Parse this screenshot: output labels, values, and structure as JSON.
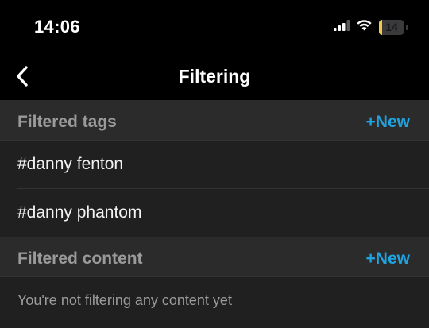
{
  "status_bar": {
    "time": "14:06",
    "battery_level": "14",
    "battery_fraction": 0.14,
    "icons": [
      "signal-bars-icon",
      "wifi-icon",
      "battery-icon"
    ],
    "battery_color": "#f4c84a"
  },
  "nav": {
    "back_icon": "chevron-left-icon",
    "title": "Filtering"
  },
  "sections": {
    "tags": {
      "title": "Filtered tags",
      "new_label": "+New",
      "items": [
        {
          "label": "#danny fenton"
        },
        {
          "label": "#danny phantom"
        }
      ]
    },
    "content": {
      "title": "Filtered content",
      "new_label": "+New",
      "empty_text": "You're not filtering any content yet"
    }
  },
  "colors": {
    "accent": "#1fa3e0",
    "background": "#202020",
    "header_background": "#2b2b2b",
    "section_title": "#9a9a9a"
  }
}
